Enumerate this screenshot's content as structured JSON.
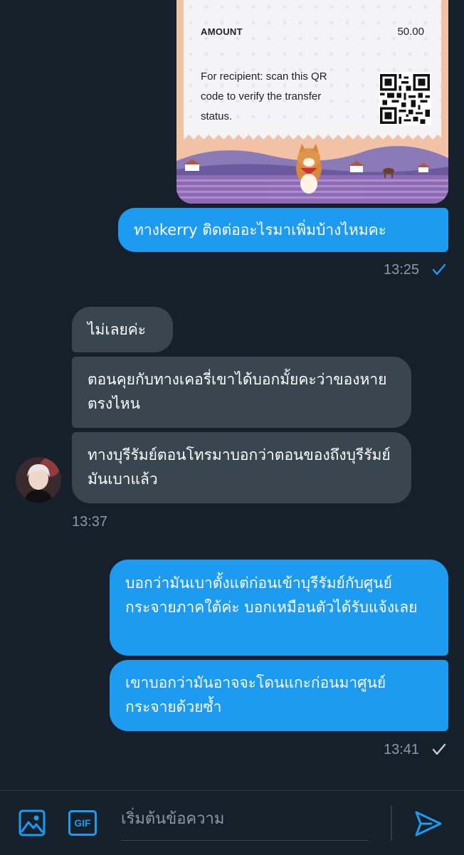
{
  "receipt": {
    "amount_label": "AMOUNT",
    "amount_value": "50.00",
    "recipient_note": "For recipient: scan this QR code to verify the transfer status."
  },
  "messages": [
    {
      "direction": "outgoing",
      "text": "ทางkerry ติดต่ออะไรมาเพิ่มบ้างไหมคะ"
    },
    {
      "direction": "incoming",
      "text": "ไม่เลยค่ะ"
    },
    {
      "direction": "incoming",
      "text": "ตอนคุยกับทางเคอรี่เขาได้บอกมั้ยคะว่าของหายตรงไหน"
    },
    {
      "direction": "incoming",
      "text": "ทางบุรีรัมย์ตอนโทรมาบอกว่าตอนของถึงบุรีรัมย์มันเบาแล้ว"
    },
    {
      "direction": "outgoing",
      "text": "บอกว่ามันเบาตั้งแต่ก่อนเข้าบุรีรัมย์กับศูนย์กระจายภาคใต้ค่ะ บอกเหมือนตัวได้รับแจ้งเลย"
    },
    {
      "direction": "outgoing",
      "text": "เขาบอกว่ามันอาจจะโดนแกะก่อนมาศูนย์กระจายด้วยซ้ำ"
    }
  ],
  "timestamps": {
    "outgoing_1": "13:25",
    "incoming_group": "13:37",
    "outgoing_2": "13:41"
  },
  "composer": {
    "placeholder": "เริ่มต้นข้อความ",
    "gif_label": "GIF",
    "icons": [
      "image-icon",
      "gif-icon",
      "send-icon"
    ]
  },
  "colors": {
    "background": "#15202b",
    "outgoing_bubble": "#1d9bf0",
    "incoming_bubble": "#39454f",
    "accent": "#1d9bf0",
    "timestamp": "#8b98a5"
  }
}
